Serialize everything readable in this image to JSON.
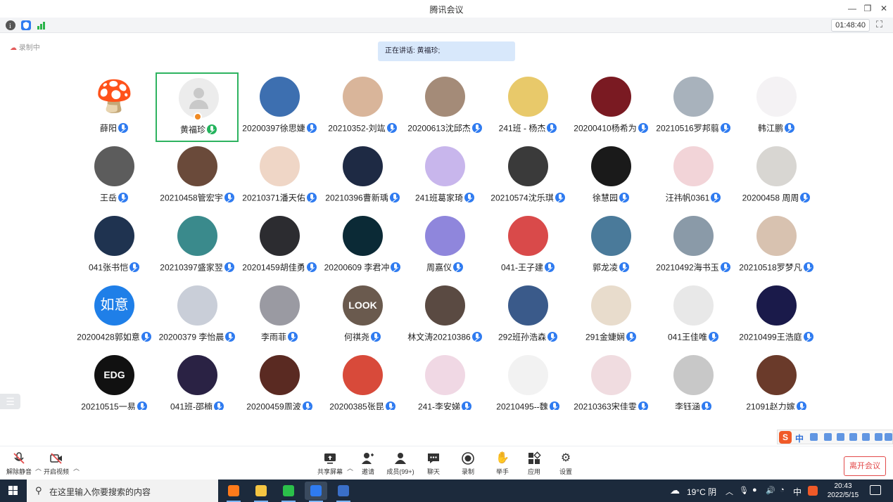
{
  "window": {
    "title": "腾讯会议",
    "controls": [
      "minimize-icon",
      "restore-icon",
      "close-icon"
    ]
  },
  "infobar": {
    "icons": [
      "info-icon",
      "shield-icon",
      "signal-icon"
    ],
    "timer": "01:48:40",
    "fullscreen_icon": "fullscreen-icon"
  },
  "recording_label": "录制中",
  "speaking_banner": "正在讲话: 黄福珍;",
  "participants": [
    {
      "name": "薛阳",
      "avatar": {
        "kind": "glyph",
        "glyph": "🍄",
        "bg": "#ffffff"
      }
    },
    {
      "name": "黄福珍",
      "avatar": {
        "kind": "placeholder"
      },
      "host": true,
      "active": true
    },
    {
      "name": "20200397徐思婕",
      "avatar": {
        "kind": "color",
        "bg": "#3d6fb0"
      }
    },
    {
      "name": "20210352-刘竑",
      "avatar": {
        "kind": "color",
        "bg": "#d9b59a"
      }
    },
    {
      "name": "20200613沈邱杰",
      "avatar": {
        "kind": "color",
        "bg": "#a48b78"
      }
    },
    {
      "name": "241班 - 杨杰",
      "avatar": {
        "kind": "color",
        "bg": "#e8c96a"
      }
    },
    {
      "name": "20200410杨希为",
      "avatar": {
        "kind": "color",
        "bg": "#7a1a22"
      }
    },
    {
      "name": "20210516罗邦翦",
      "avatar": {
        "kind": "color",
        "bg": "#a8b2bc"
      }
    },
    {
      "name": "韩江鹏",
      "avatar": {
        "kind": "color",
        "bg": "#f4f2f4"
      }
    },
    {
      "name": "王岳",
      "avatar": {
        "kind": "color",
        "bg": "#5c5c5c"
      }
    },
    {
      "name": "20210458管宏宇",
      "avatar": {
        "kind": "color",
        "bg": "#6a4a3a"
      }
    },
    {
      "name": "20210371潘天佑",
      "avatar": {
        "kind": "color",
        "bg": "#efd6c6"
      }
    },
    {
      "name": "20210396曹新瑀",
      "avatar": {
        "kind": "color",
        "bg": "#1e2a44"
      }
    },
    {
      "name": "241班葛家琦",
      "avatar": {
        "kind": "color",
        "bg": "#c8b6ec"
      }
    },
    {
      "name": "20210574沈乐琪",
      "avatar": {
        "kind": "color",
        "bg": "#3a3a3a"
      }
    },
    {
      "name": "徐慧园",
      "avatar": {
        "kind": "color",
        "bg": "#1a1a1a"
      }
    },
    {
      "name": "汪祎帆0361",
      "avatar": {
        "kind": "color",
        "bg": "#f2d4d8"
      }
    },
    {
      "name": "20200458 周周",
      "avatar": {
        "kind": "color",
        "bg": "#d8d6d2"
      }
    },
    {
      "name": "041张书恺",
      "avatar": {
        "kind": "color",
        "bg": "#1f3350"
      }
    },
    {
      "name": "20210397盛家翌",
      "avatar": {
        "kind": "color",
        "bg": "#3a8a8c"
      }
    },
    {
      "name": "20201459胡佳勇",
      "avatar": {
        "kind": "color",
        "bg": "#2c2c30"
      }
    },
    {
      "name": "20200609 李君冲",
      "avatar": {
        "kind": "color",
        "bg": "#0b2a36"
      }
    },
    {
      "name": "周嘉仪",
      "avatar": {
        "kind": "color",
        "bg": "#8f86dc"
      }
    },
    {
      "name": "041-王子建",
      "avatar": {
        "kind": "color",
        "bg": "#d94a4a"
      }
    },
    {
      "name": "郭龙凌",
      "avatar": {
        "kind": "color",
        "bg": "#4a7a9a"
      }
    },
    {
      "name": "20210492海书玉",
      "avatar": {
        "kind": "color",
        "bg": "#8a9aa8"
      }
    },
    {
      "name": "20210518罗梦凡",
      "avatar": {
        "kind": "color",
        "bg": "#d8c2b0"
      }
    },
    {
      "name": "20200428郭如意",
      "avatar": {
        "kind": "text",
        "text": "如意",
        "bg": "#1f7fe8"
      }
    },
    {
      "name": "20200379 李怡晨",
      "avatar": {
        "kind": "color",
        "bg": "#c9ced8"
      }
    },
    {
      "name": "李雨菲",
      "avatar": {
        "kind": "color",
        "bg": "#9a9aa2"
      }
    },
    {
      "name": "何祺尧",
      "avatar": {
        "kind": "text",
        "text": "LOOK",
        "bg": "#6a5a4e"
      }
    },
    {
      "name": "林文涛20210386",
      "avatar": {
        "kind": "color",
        "bg": "#5a4a42"
      }
    },
    {
      "name": "292班孙浩森",
      "avatar": {
        "kind": "color",
        "bg": "#3a5a8a"
      }
    },
    {
      "name": "291金婕娴",
      "avatar": {
        "kind": "color",
        "bg": "#e8dccc"
      }
    },
    {
      "name": "041王佳唯",
      "avatar": {
        "kind": "color",
        "bg": "#e8e8e8"
      }
    },
    {
      "name": "20210499王浩庭",
      "avatar": {
        "kind": "color",
        "bg": "#1a1a4a"
      }
    },
    {
      "name": "20210515一易",
      "avatar": {
        "kind": "text",
        "text": "EDG",
        "bg": "#111111"
      }
    },
    {
      "name": "041班-邵楠",
      "avatar": {
        "kind": "color",
        "bg": "#2a2244"
      }
    },
    {
      "name": "20200459周波",
      "avatar": {
        "kind": "color",
        "bg": "#5a2a22"
      }
    },
    {
      "name": "20200385张昆",
      "avatar": {
        "kind": "color",
        "bg": "#d84a3a"
      }
    },
    {
      "name": "241-李安娣",
      "avatar": {
        "kind": "color",
        "bg": "#f0d8e4"
      }
    },
    {
      "name": "20210495--魏",
      "avatar": {
        "kind": "color",
        "bg": "#f2f2f2"
      }
    },
    {
      "name": "20210363宋佳雯",
      "avatar": {
        "kind": "color",
        "bg": "#f0dce0"
      }
    },
    {
      "name": "李钰涵",
      "avatar": {
        "kind": "color",
        "bg": "#c8c8c8"
      }
    },
    {
      "name": "21091赵力嫁",
      "avatar": {
        "kind": "color",
        "bg": "#6a3a2a"
      }
    }
  ],
  "toolbar": {
    "mute": "解除静音",
    "video": "开启视频",
    "share": "共享屏幕",
    "invite": "邀请",
    "members": "成员(99+)",
    "chat": "聊天",
    "record": "录制",
    "raise_hand": "举手",
    "apps": "应用",
    "settings": "设置",
    "leave": "离开会议"
  },
  "ime": {
    "logo": "S",
    "lang": "中"
  },
  "taskbar": {
    "search_placeholder": "在这里输入你要搜索的内容",
    "weather": "19°C 阴",
    "ime_lang": "中",
    "time": "20:43",
    "date": "2022/5/15",
    "apps": [
      {
        "name": "firefox-app",
        "color": "#ff7a1a"
      },
      {
        "name": "file-explorer-app",
        "color": "#f5c542"
      },
      {
        "name": "wechat-app",
        "color": "#2bc04a"
      },
      {
        "name": "tencent-meeting-app",
        "color": "#2f7bf0"
      },
      {
        "name": "word-app",
        "color": "#3a6fc8"
      }
    ]
  }
}
